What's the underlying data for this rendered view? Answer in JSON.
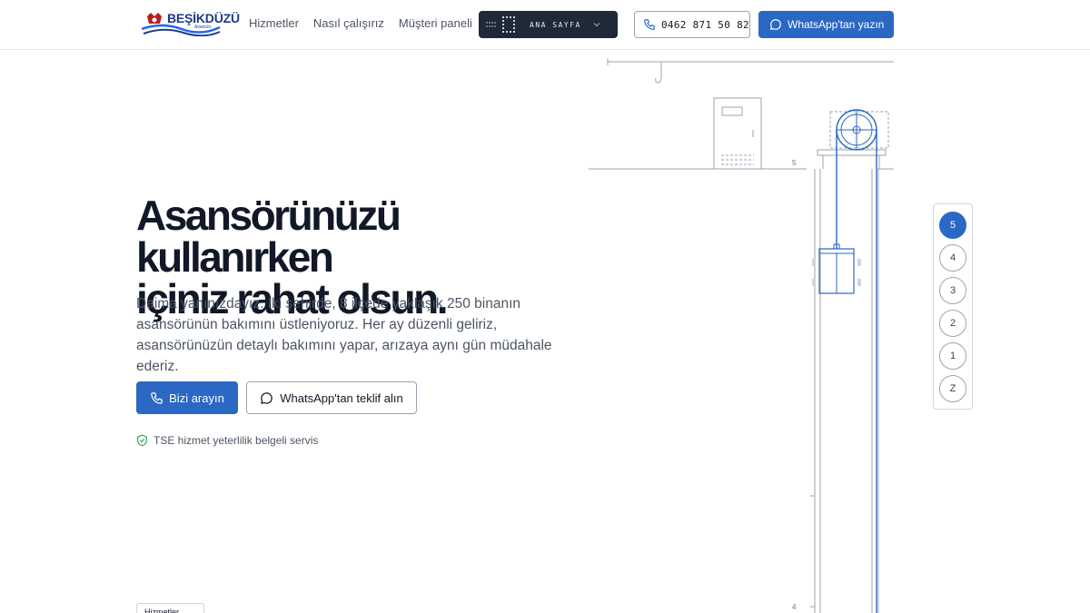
{
  "header": {
    "logo": {
      "name": "BEŞİKDÜZÜ",
      "sub": "Asansör"
    },
    "nav": [
      "Hizmetler",
      "Nasıl çalışırız",
      "Müşteri paneli"
    ],
    "floor_select": {
      "label": "ANA SAYFA"
    },
    "phone": "0462 871 50 82",
    "whatsapp_label": "WhatsApp'tan yazın"
  },
  "hero": {
    "title_line1": "Asansörünüzü kullanırken",
    "title_line2": "içiniz rahat olsun.",
    "subtitle": "Daima yanınızdayız. İki şehirde, 8 ilçede yaklaşık 250 binanın asansörünün bakımını üstleniyoruz. Her ay düzenli geliriz, asansörünüzün detaylı bakımını yapar, arızaya aynı gün müdahale ederiz.",
    "cta_call": "Bizi arayın",
    "cta_whatsapp": "WhatsApp'tan teklif alın",
    "badge": "TSE hizmet yeterlilik belgeli servis"
  },
  "services_chip": "Hizmetler",
  "illustration": {
    "floor_label_top": "5",
    "floor_label_bottom": "4"
  },
  "floor_panel": {
    "floors": [
      "5",
      "4",
      "3",
      "2",
      "1",
      "Z"
    ],
    "active": "5"
  },
  "colors": {
    "accent": "#2a68c4",
    "dark": "#1f2937",
    "line": "#9ca3af"
  },
  "icons": [
    "phone-icon",
    "whatsapp-icon",
    "chevron-down-icon",
    "shield-check-icon",
    "grid-dots-icon"
  ]
}
